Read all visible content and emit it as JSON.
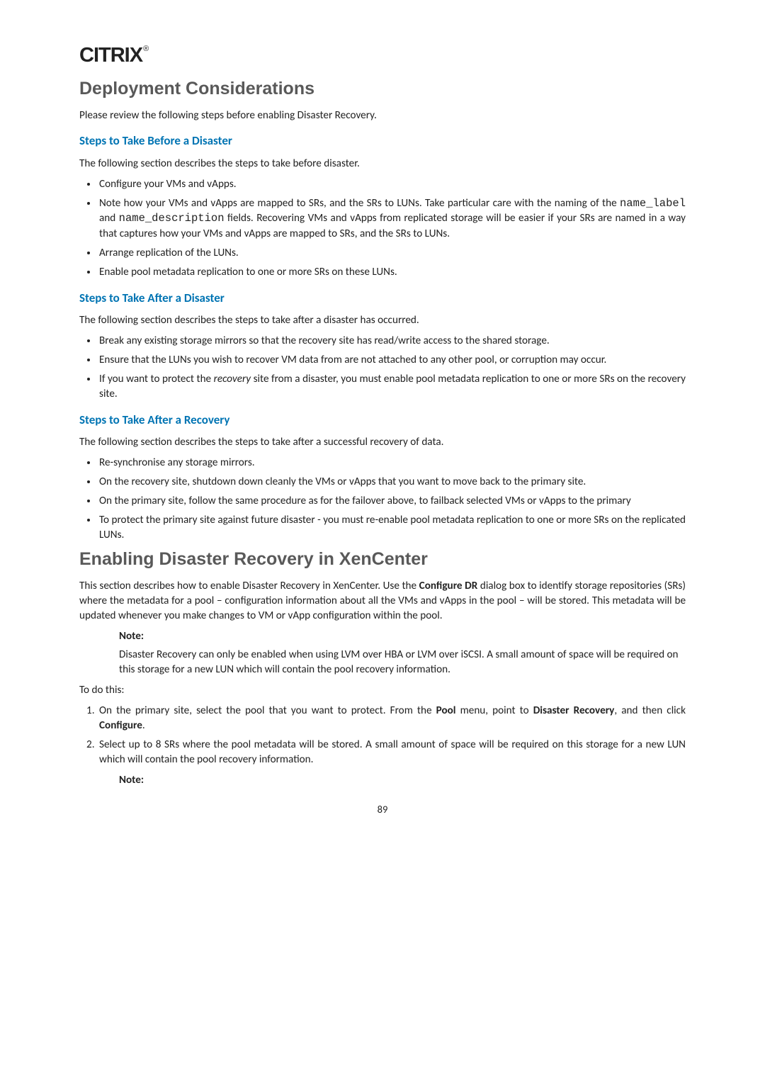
{
  "logo": "CITRIX",
  "h1a": "Deployment Considerations",
  "p_intro1": "Please review the following steps before enabling Disaster Recovery.",
  "sec1_title": "Steps to Take Before a Disaster",
  "sec1_intro": "The following section describes the steps to take before disaster.",
  "sec1_li1": "Configure your VMs and vApps.",
  "sec1_li2a": "Note how your VMs and vApps are mapped to SRs, and the SRs to LUNs. Take particular care with the naming of the ",
  "sec1_li2_code1": "name_label",
  "sec1_li2b": " and ",
  "sec1_li2_code2": "name_description",
  "sec1_li2c": " fields. Recovering VMs and vApps from replicated storage will be easier if your SRs are named in a way that captures how your VMs and vApps are mapped to SRs, and the SRs to LUNs.",
  "sec1_li3": "Arrange replication of the LUNs.",
  "sec1_li4": "Enable pool metadata replication to one or more SRs on these LUNs.",
  "sec2_title": "Steps to Take After a Disaster",
  "sec2_intro": "The following section describes the steps to take after a disaster has occurred.",
  "sec2_li1": "Break any existing storage mirrors so that the recovery site has read/write access to the shared storage.",
  "sec2_li2": "Ensure that the LUNs you wish to recover VM data from are not attached to any other pool, or corruption may occur.",
  "sec2_li3a": "If you want to protect the ",
  "sec2_li3_em": "recovery",
  "sec2_li3b": " site from a disaster, you must enable pool metadata replication to one or more SRs on the recovery site.",
  "sec3_title": "Steps to Take After a Recovery",
  "sec3_intro": "The following section describes the steps to take after a successful recovery of data.",
  "sec3_li1": "Re-synchronise any storage mirrors.",
  "sec3_li2": "On the recovery site, shutdown down cleanly the VMs or vApps that you want to move back to the primary site.",
  "sec3_li3": "On the primary site, follow the same procedure as for the failover above, to failback selected VMs or vApps to the primary",
  "sec3_li4": "To protect the primary site against future disaster - you must re-enable pool metadata replication to one or more SRs on the replicated LUNs.",
  "h1b": "Enabling Disaster Recovery in XenCenter",
  "p_enable_a": "This section describes how to enable Disaster Recovery in XenCenter. Use the ",
  "p_enable_b1": "Configure DR",
  "p_enable_b": " dialog box to identify storage repositories (SRs) where the metadata for a pool – configuration information about all the VMs and vApps in the pool – will be stored. This metadata will be updated whenever you make changes to VM or vApp configuration within the pool.",
  "note1_title": "Note:",
  "note1_body": "Disaster Recovery can only be enabled when using LVM over HBA or LVM over iSCSI. A small amount of space will be required on this storage for a new LUN which will contain the pool recovery information.",
  "todo": "To do this:",
  "ol_li1a": "On the primary site, select the pool that you want to protect. From the ",
  "ol_li1_b1": "Pool",
  "ol_li1b": " menu, point to  ",
  "ol_li1_b2": "Disaster Recovery",
  "ol_li1c": ", and then click ",
  "ol_li1_b3": "Configure",
  "ol_li1d": ".",
  "ol_li2": "Select up to 8 SRs where the pool metadata will be stored. A small amount of space will be required on this storage for a new LUN which will contain the pool recovery information.",
  "note2_title": "Note:",
  "pagenum": "89"
}
